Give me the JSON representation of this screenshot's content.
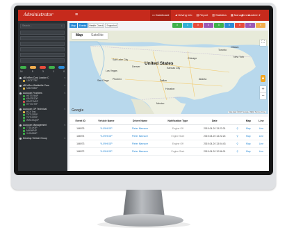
{
  "app": {
    "brand": "Administrator",
    "user": "admin"
  },
  "topnav": [
    {
      "icon": "monitor-icon",
      "label": "Dashboard",
      "active": true
    },
    {
      "icon": "car-icon",
      "label": "Driving info",
      "active": false
    },
    {
      "icon": "file-icon",
      "label": "Report",
      "active": false
    },
    {
      "icon": "chart-icon",
      "label": "Statistics",
      "active": false
    },
    {
      "icon": "grid-icon",
      "label": "Management",
      "active": false
    }
  ],
  "sidebar": {
    "search_placeholder": "Search...",
    "legend": [
      "",
      "",
      "",
      "",
      ""
    ],
    "counts": [
      "14",
      "5",
      "3",
      "1",
      "0"
    ],
    "groups": [
      {
        "title": "dB InRev Cost London C",
        "vehicles": [
          {
            "label": "1DC3T7BC",
            "color": "#e0b84a"
          }
        ]
      },
      {
        "title": "dB InRev Walderille Care",
        "vehicles": [
          {
            "label": "MM2998ZP",
            "color": "#e0b84a"
          }
        ]
      },
      {
        "title": "Autocom Frontiers",
        "vehicles": [
          {
            "label": "HETSYM4P",
            "color": "#3fb14b"
          },
          {
            "label": "KR4TR2DP",
            "color": "#3fb14b"
          },
          {
            "label": "KD4TYM0P",
            "color": "#d9534f"
          },
          {
            "label": "HYTJCT9P",
            "color": "#3fb14b"
          }
        ]
      },
      {
        "title": "Autocom GP Technical",
        "vehicles": [
          {
            "label": "HCX Test",
            "color": "#e0b84a"
          },
          {
            "label": "TVT1CR0P",
            "color": "#3fb14b"
          },
          {
            "label": "TVT1CR2P",
            "color": "#3fb14b"
          },
          {
            "label": "WW19AQ0P",
            "color": "#3fb14b"
          }
        ]
      },
      {
        "title": "Autocom Management",
        "vehicles": [
          {
            "label": "T7D1LK0P",
            "color": "#3fb14b"
          },
          {
            "label": "MH0HP4P",
            "color": "#3fb14b"
          },
          {
            "label": "VL09AB0P",
            "color": "#3fb14b"
          }
        ]
      },
      {
        "title": "Develop Vehicle Group",
        "vehicles": []
      }
    ]
  },
  "toolbar": {
    "buttons": [
      "Map",
      "Events",
      "Health Check",
      "Snapshot"
    ],
    "status_buttons": [
      {
        "label": "0",
        "color": "#3fb14b"
      },
      {
        "label": "1",
        "color": "#31b0d5"
      },
      {
        "label": "0",
        "color": "#e74c3c"
      },
      {
        "label": "0",
        "color": "#9b59b6"
      },
      {
        "label": "0",
        "color": "#3fb14b"
      },
      {
        "label": "0",
        "color": "#2c8bd6"
      },
      {
        "label": "0",
        "color": "#e74c3c"
      },
      {
        "label": "0",
        "color": "#9b59b6"
      },
      {
        "label": "0",
        "color": "#f0ad4e"
      }
    ]
  },
  "map": {
    "tabs": [
      "Map",
      "Satellite"
    ],
    "labels": [
      "United States",
      "Mexico",
      "Salt Lake City",
      "Denver",
      "Chicago",
      "New York",
      "Dallas",
      "Houston",
      "San Diego",
      "Las Vegas",
      "Phoenix",
      "Kansas City",
      "Atlanta",
      "Toronto",
      "Ottawa"
    ],
    "logo": "Google",
    "terms": "Map data ©2017 Google, INEGI   Terms of Use"
  },
  "table": {
    "columns": [
      "Event ID",
      "Vehicle Name",
      "Driver Name",
      "Notification Type",
      "Date",
      "",
      "Map",
      "Line"
    ],
    "rows": [
      {
        "event_id": "166975",
        "vehicle": "YL09HKGP",
        "driver": "Pieter Marnane",
        "type": "Engine Off",
        "date": "2019-04-20 13:23:31",
        "map": "Map",
        "line": "Line"
      },
      {
        "event_id": "166974",
        "vehicle": "YL09HKGP",
        "driver": "Pieter Marnane",
        "type": "Engine Start",
        "date": "2019-04-20 13:22:24",
        "map": "Map",
        "line": "Line"
      },
      {
        "event_id": "166973",
        "vehicle": "YL09HKGP",
        "driver": "Pieter Marnane",
        "type": "Engine Off",
        "date": "2019-04-20 13:04:43",
        "map": "Map",
        "line": "Line"
      },
      {
        "event_id": "166972",
        "vehicle": "YL09HKGP",
        "driver": "Pieter Marnane",
        "type": "Engine Start",
        "date": "2019-04-20 12:56:01",
        "map": "Map",
        "line": "Line"
      }
    ]
  },
  "colors": {
    "brand_red": "#c62a1c",
    "sidebar_bg": "#2b2f33",
    "accent_blue": "#2c8bd6"
  }
}
